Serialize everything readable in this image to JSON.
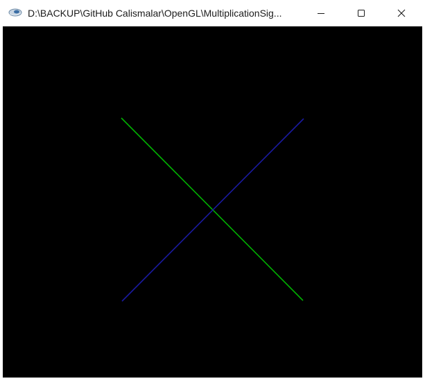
{
  "window": {
    "title": "D:\\BACKUP\\GitHub Calismalar\\OpenGL\\MultiplicationSig...",
    "icons": {
      "app": "opengl-app-icon",
      "minimize": "minimize-icon",
      "maximize": "maximize-icon",
      "close": "close-icon"
    }
  },
  "canvas": {
    "background": "#000000",
    "lines": [
      {
        "name": "green-diagonal-line",
        "color": "#00b000"
      },
      {
        "name": "blue-diagonal-line",
        "color": "#1a1aa0"
      }
    ]
  }
}
